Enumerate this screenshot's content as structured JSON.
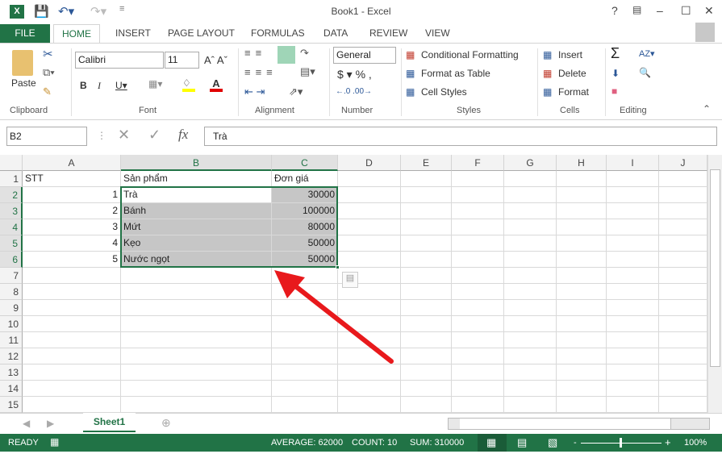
{
  "window": {
    "title": "Book1 - Excel"
  },
  "tabs": [
    {
      "label": "FILE"
    },
    {
      "label": "HOME"
    },
    {
      "label": "INSERT"
    },
    {
      "label": "PAGE LAYOUT"
    },
    {
      "label": "FORMULAS"
    },
    {
      "label": "DATA"
    },
    {
      "label": "REVIEW"
    },
    {
      "label": "VIEW"
    }
  ],
  "ribbon": {
    "clipboard": {
      "label": "Clipboard",
      "paste": "Paste"
    },
    "font": {
      "label": "Font",
      "name": "Calibri",
      "size": "11"
    },
    "alignment": {
      "label": "Alignment"
    },
    "number": {
      "label": "Number",
      "format": "General"
    },
    "styles": {
      "label": "Styles",
      "conditional": "Conditional Formatting",
      "format_table": "Format as Table",
      "cell_styles": "Cell Styles"
    },
    "cells": {
      "label": "Cells",
      "insert": "Insert",
      "delete": "Delete",
      "format": "Format"
    },
    "editing": {
      "label": "Editing"
    }
  },
  "formula_bar": {
    "name_box": "B2",
    "value": "Trà"
  },
  "columns": [
    "A",
    "B",
    "C",
    "D",
    "E",
    "F",
    "G",
    "H",
    "I",
    "J"
  ],
  "rows": [
    "1",
    "2",
    "3",
    "4",
    "5",
    "6",
    "7",
    "8",
    "9",
    "10",
    "11",
    "12",
    "13",
    "14",
    "15"
  ],
  "cells": [
    [
      "STT",
      "Sản phẩm",
      "Đơn giá"
    ],
    [
      "1",
      "Trà",
      "30000"
    ],
    [
      "2",
      "Bánh",
      "100000"
    ],
    [
      "3",
      "Mứt",
      "80000"
    ],
    [
      "4",
      "Kẹo",
      "50000"
    ],
    [
      "5",
      "Nước ngọt",
      "50000"
    ]
  ],
  "sheets": [
    {
      "name": "Sheet1"
    }
  ],
  "status": {
    "ready": "READY",
    "average": "AVERAGE: 62000",
    "count": "COUNT: 10",
    "sum": "SUM: 310000",
    "zoom": "100%"
  },
  "colors": {
    "accent": "#217346",
    "arrow": "#e8191c"
  }
}
